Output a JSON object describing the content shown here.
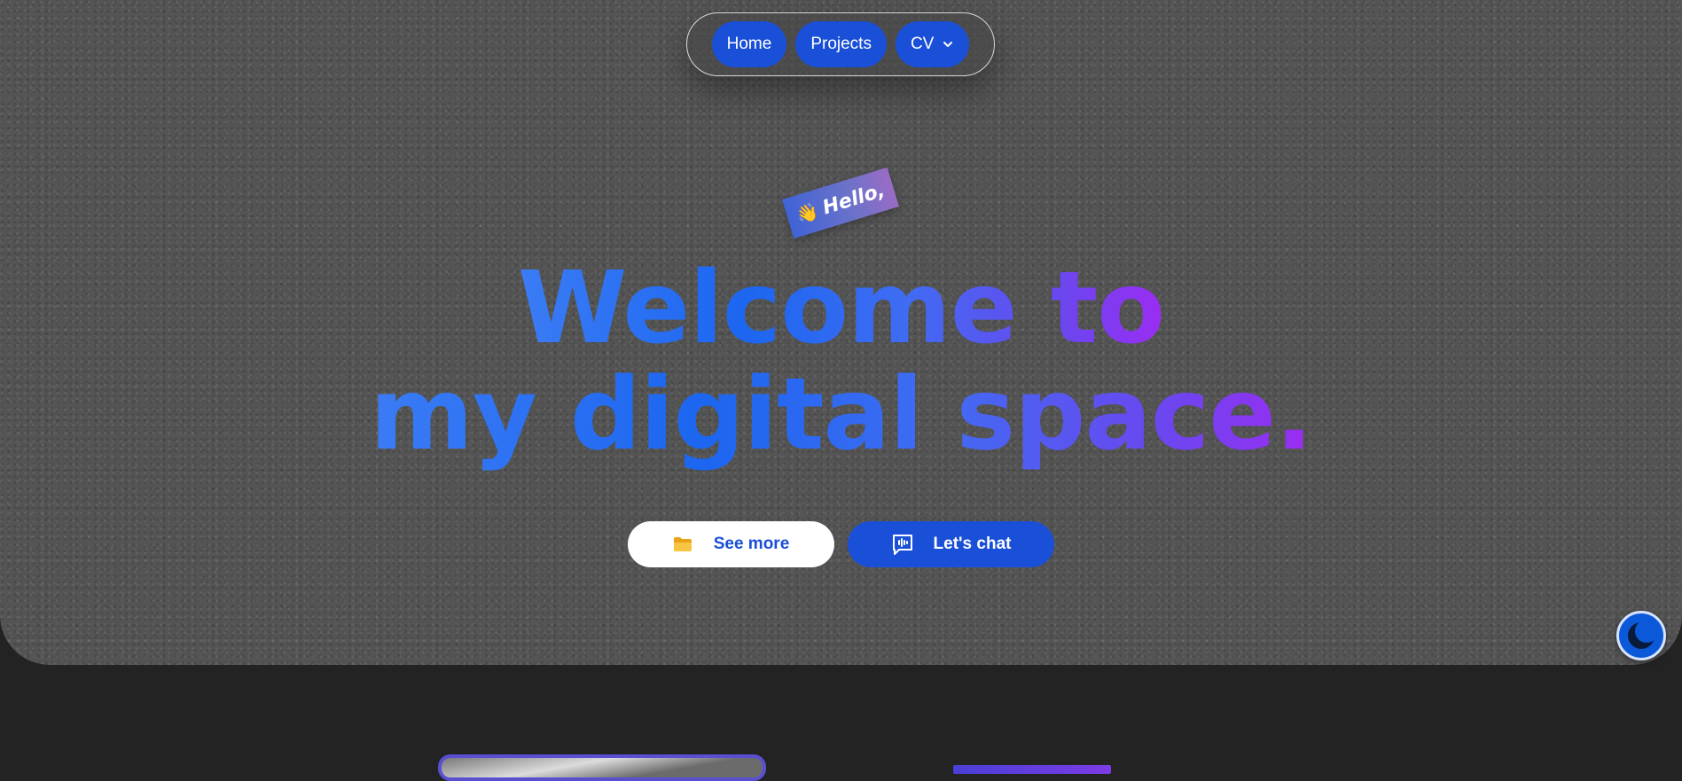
{
  "nav": {
    "items": [
      {
        "label": "Home"
      },
      {
        "label": "Projects"
      },
      {
        "label": "CV",
        "has_dropdown": true
      }
    ],
    "chevron_icon": "chevron-down-icon"
  },
  "hero": {
    "tag": {
      "emoji": "👋",
      "text": "Hello,"
    },
    "headline": {
      "line1": "Welcome to",
      "line2": "my digital space."
    },
    "buttons": {
      "see_more": {
        "label": "See more",
        "icon": "folder-icon"
      },
      "lets_chat": {
        "label": "Let's chat",
        "icon": "chat-voice-icon"
      }
    }
  },
  "theme_toggle": {
    "icon": "moon-icon"
  },
  "colors": {
    "accent": "#1a4fd8",
    "hero_bg": "#545454",
    "page_bg": "#232323",
    "gradient_start": "#3b7cf5",
    "gradient_end": "#9b2cf2"
  }
}
